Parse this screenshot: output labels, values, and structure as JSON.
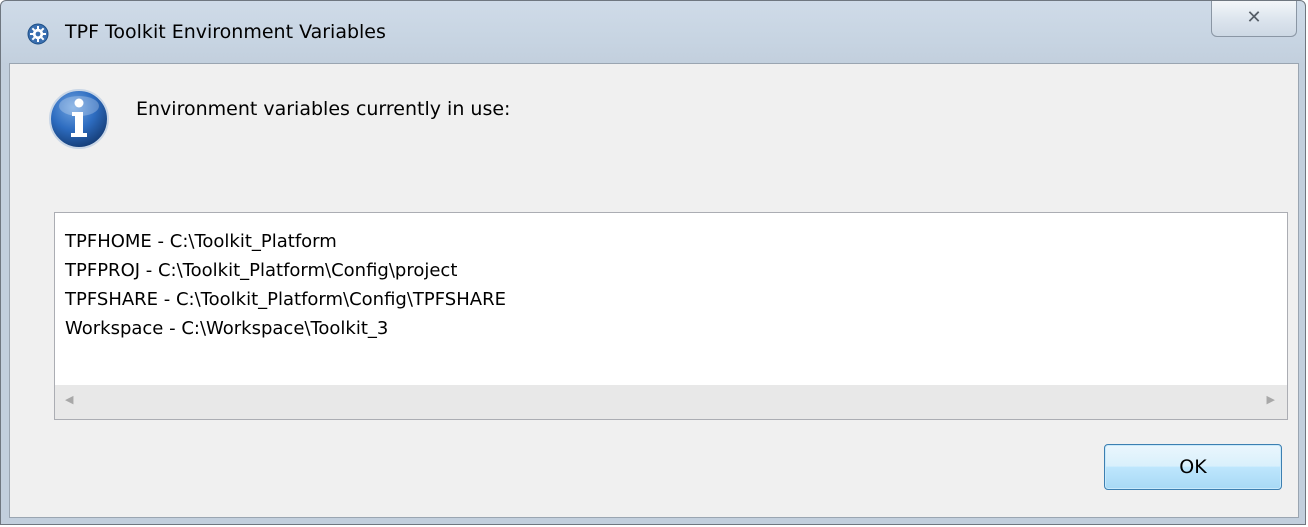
{
  "window": {
    "title": "TPF Toolkit Environment Variables",
    "app_icon": "gear-icon",
    "close_icon": "close-icon",
    "close_glyph": "✕"
  },
  "dialog": {
    "icon": "info-icon",
    "message": "Environment variables currently in use:",
    "variables": [
      "TPFHOME - C:\\Toolkit_Platform",
      "TPFPROJ - C:\\Toolkit_Platform\\Config\\project",
      "TPFSHARE - C:\\Toolkit_Platform\\Config\\TPFSHARE",
      "Workspace - C:\\Workspace\\Toolkit_3"
    ],
    "scroll_left_glyph": "◀",
    "scroll_right_glyph": "▶",
    "ok_label": "OK"
  },
  "colors": {
    "titlebar": "#cfdbe8",
    "client_background": "#f0f0f0",
    "info_icon_blue": "#1f5fae",
    "ok_button_border": "#3c7fb1"
  }
}
